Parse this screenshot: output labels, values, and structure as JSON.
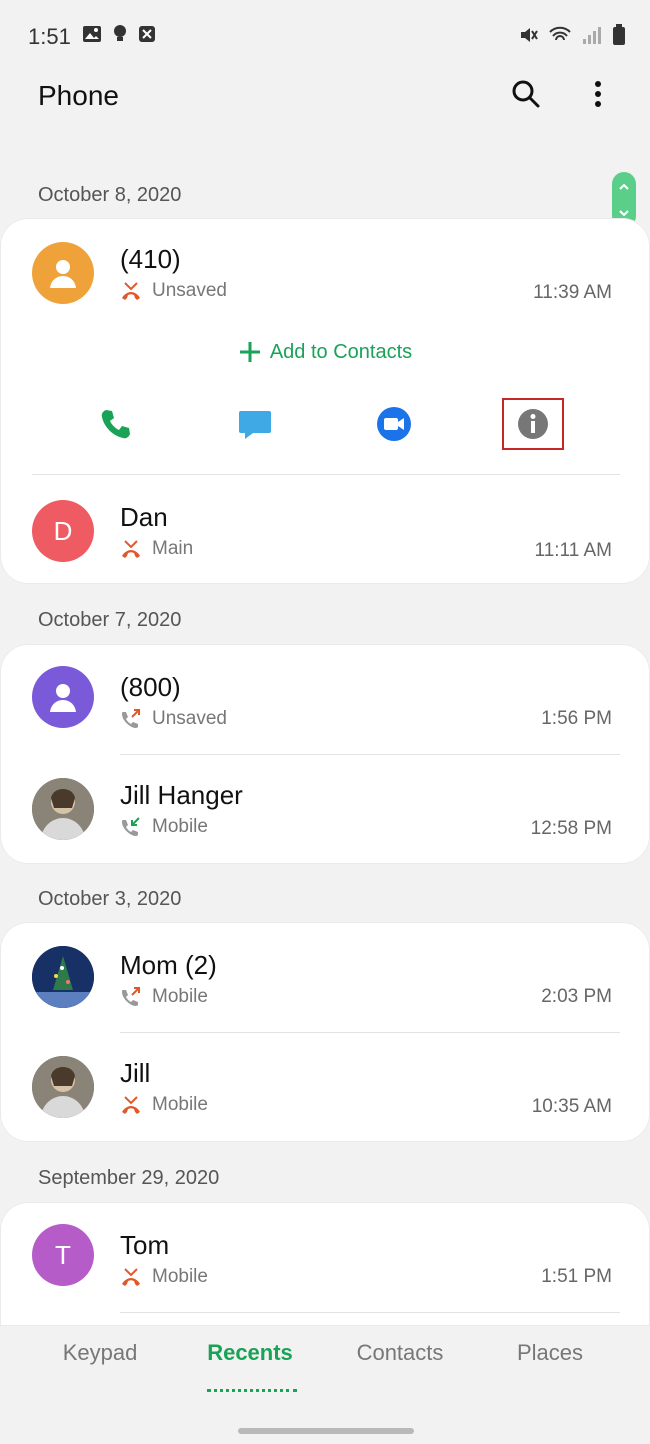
{
  "status_bar": {
    "time": "1:51"
  },
  "app_bar": {
    "title": "Phone"
  },
  "groups": [
    {
      "date": "October 8, 2020",
      "calls": [
        {
          "name": "(410)",
          "type": "Unsaved",
          "time": "11:39 AM",
          "direction": "missed",
          "expanded": true
        },
        {
          "name": "Dan",
          "type": "Main",
          "time": "11:11 AM",
          "direction": "missed",
          "avatar_letter": "D"
        }
      ],
      "add_to_contacts": "Add to Contacts"
    },
    {
      "date": "October 7, 2020",
      "calls": [
        {
          "name": "(800)",
          "type": "Unsaved",
          "time": "1:56 PM",
          "direction": "outgoing"
        },
        {
          "name": "Jill Hanger",
          "type": "Mobile",
          "time": "12:58 PM",
          "direction": "incoming"
        }
      ]
    },
    {
      "date": "October 3, 2020",
      "calls": [
        {
          "name": "Mom (2)",
          "type": "Mobile",
          "time": "2:03 PM",
          "direction": "outgoing"
        },
        {
          "name": "Jill",
          "type": "Mobile",
          "time": "10:35 AM",
          "direction": "missed"
        }
      ]
    },
    {
      "date": "September 29, 2020",
      "calls": [
        {
          "name": "Tom",
          "type": "Mobile",
          "time": "1:51 PM",
          "direction": "missed",
          "avatar_letter": "T"
        }
      ]
    }
  ],
  "tabs": [
    {
      "label": "Keypad"
    },
    {
      "label": "Recents",
      "active": true
    },
    {
      "label": "Contacts"
    },
    {
      "label": "Places"
    }
  ],
  "colors": {
    "accent": "#1aa257",
    "missed": "#e0572a",
    "highlight": "#c62828"
  },
  "icons": {
    "search": "search-icon",
    "more": "more-vert-icon",
    "call": "phone-icon",
    "message": "message-icon",
    "video": "video-call-icon",
    "info": "info-icon"
  }
}
